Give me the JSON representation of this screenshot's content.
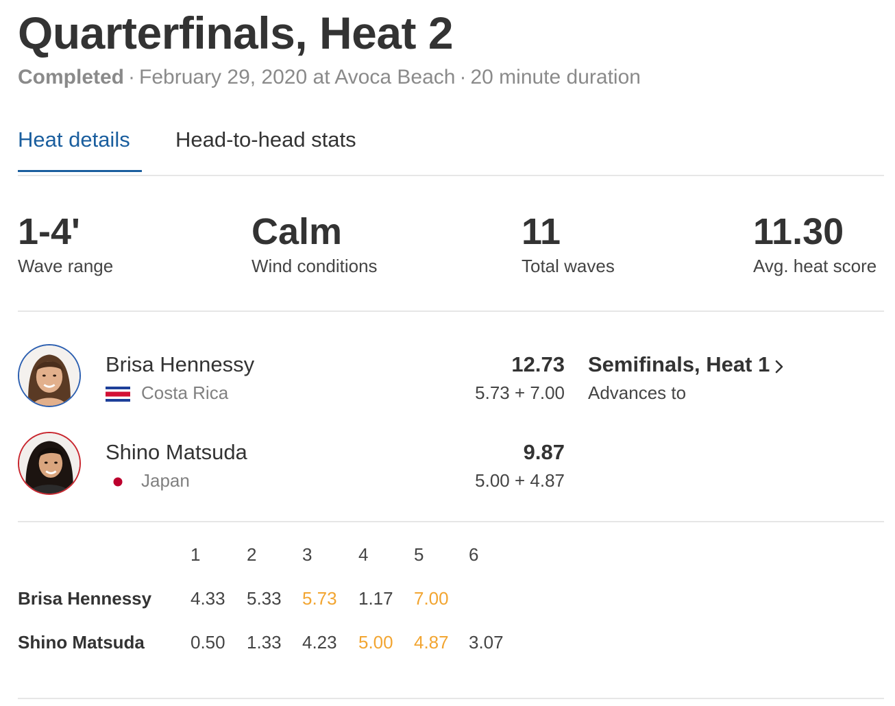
{
  "header": {
    "title": "Quarterfinals, Heat 2",
    "status": "Completed",
    "date_location": "February 29, 2020 at Avoca Beach",
    "duration": "20 minute duration",
    "separator": "·"
  },
  "tabs": [
    {
      "label": "Heat details",
      "active": true
    },
    {
      "label": "Head-to-head stats",
      "active": false
    }
  ],
  "stats": [
    {
      "value": "1-4'",
      "label": "Wave range"
    },
    {
      "value": "Calm",
      "label": "Wind conditions"
    },
    {
      "value": "11",
      "label": "Total waves"
    },
    {
      "value": "11.30",
      "label": "Avg. heat score"
    }
  ],
  "athletes": [
    {
      "name": "Brisa Hennessy",
      "country": "Costa Rica",
      "flag_icon": "costa-rica-flag-icon",
      "total": "12.73",
      "best_two": "5.73 + 7.00",
      "advance_to": "Semifinals, Heat 1",
      "advance_label": "Advances to",
      "ring_color": "#2c5fb0"
    },
    {
      "name": "Shino Matsuda",
      "country": "Japan",
      "flag_icon": "japan-flag-icon",
      "total": "9.87",
      "best_two": "5.00 + 4.87",
      "ring_color": "#c8262e"
    }
  ],
  "waves": {
    "headers": [
      "1",
      "2",
      "3",
      "4",
      "5",
      "6"
    ],
    "highlight_color": "#f2a531",
    "rows": [
      {
        "name": "Brisa Hennessy",
        "scores": [
          {
            "value": "4.33",
            "best": false
          },
          {
            "value": "5.33",
            "best": false
          },
          {
            "value": "5.73",
            "best": true
          },
          {
            "value": "1.17",
            "best": false
          },
          {
            "value": "7.00",
            "best": true
          }
        ]
      },
      {
        "name": "Shino Matsuda",
        "scores": [
          {
            "value": "0.50",
            "best": false
          },
          {
            "value": "1.33",
            "best": false
          },
          {
            "value": "4.23",
            "best": false
          },
          {
            "value": "5.00",
            "best": true
          },
          {
            "value": "4.87",
            "best": true
          },
          {
            "value": "3.07",
            "best": false
          }
        ]
      }
    ]
  },
  "colors": {
    "accent": "#1a5e9e",
    "text": "#333333",
    "muted": "#8a8a8a",
    "divider": "#e6e6e6"
  }
}
